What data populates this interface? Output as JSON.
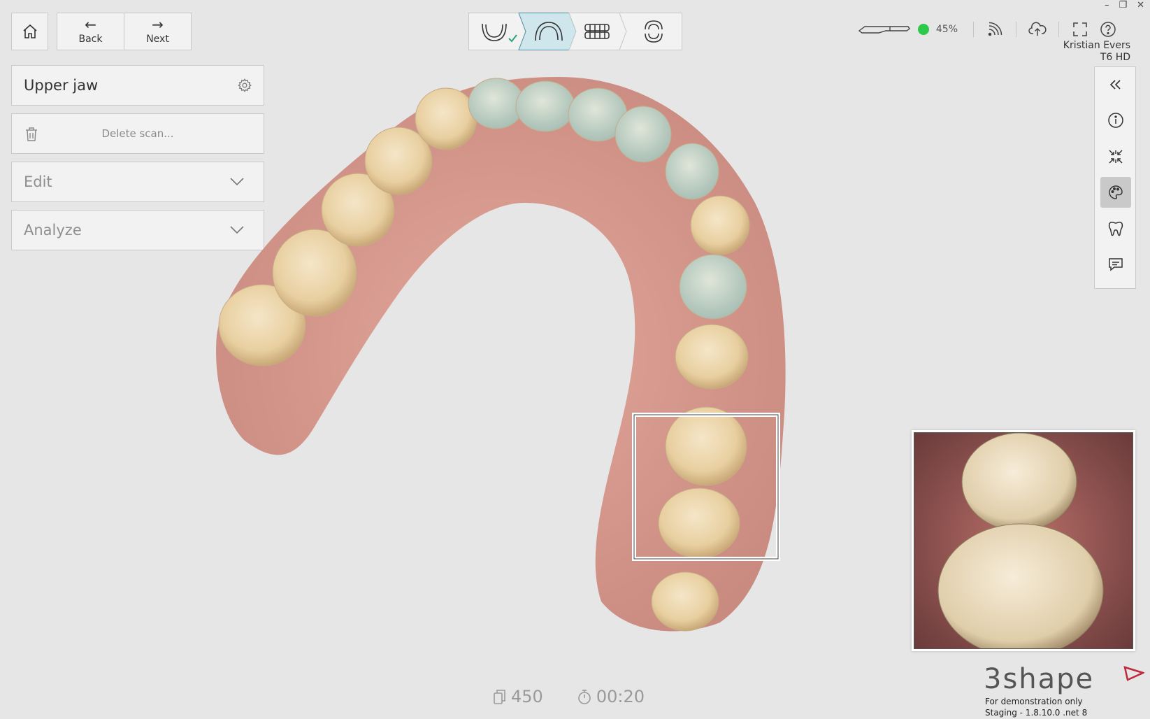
{
  "toolbar": {
    "home_icon": "home-icon",
    "back_label": "Back",
    "next_label": "Next"
  },
  "workflow": {
    "steps": [
      {
        "icon": "lower-jaw-icon",
        "completed": true
      },
      {
        "icon": "upper-jaw-icon",
        "active": true
      },
      {
        "icon": "bite-icon"
      },
      {
        "icon": "occlusion-icon"
      }
    ],
    "accent_color": "#2aa37a",
    "active_color": "#cfe6ec"
  },
  "left_panel": {
    "jaw_title": "Upper jaw",
    "delete_label": "Delete scan...",
    "edit_label": "Edit",
    "analyze_label": "Analyze"
  },
  "status": {
    "scanner_status_color": "#2ec84a",
    "scanner_percent": "45%",
    "user_name": "Kristian Evers",
    "device_name": "T6 HD"
  },
  "window_controls": {
    "minimize": "–",
    "restore": "❐",
    "close": "✕"
  },
  "right_tools": [
    {
      "icon": "collapse-icon"
    },
    {
      "icon": "info-icon"
    },
    {
      "icon": "shrink-icon"
    },
    {
      "icon": "palette-icon",
      "active": true
    },
    {
      "icon": "tooth-icon"
    },
    {
      "icon": "comment-icon"
    }
  ],
  "stats": {
    "scan_count": "450",
    "timer": "00:20"
  },
  "branding": {
    "logo_text": "3shape",
    "logo_accent": "#c0283c",
    "demo_line1": "For demonstration only",
    "demo_line2": "Staging - 1.8.10.0 .net 8"
  }
}
